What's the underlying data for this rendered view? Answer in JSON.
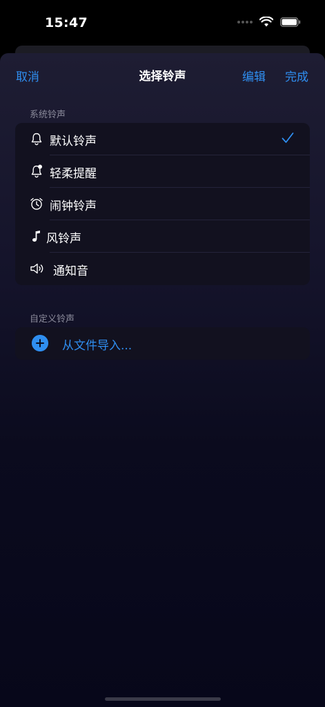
{
  "status_bar": {
    "time": "15:47"
  },
  "nav": {
    "cancel": "取消",
    "title": "选择铃声",
    "edit": "编辑",
    "done": "完成"
  },
  "sections": {
    "system": {
      "header": "系统铃声",
      "items": [
        {
          "label": "默认铃声",
          "icon": "bell-icon",
          "selected": true
        },
        {
          "label": "轻柔提醒",
          "icon": "bell-badge-icon",
          "selected": false
        },
        {
          "label": "闹钟铃声",
          "icon": "alarm-clock-icon",
          "selected": false
        },
        {
          "label": "风铃声",
          "icon": "music-note-icon",
          "selected": false
        },
        {
          "label": "通知音",
          "icon": "speaker-icon",
          "selected": false
        }
      ]
    },
    "custom": {
      "header": "自定义铃声",
      "import_label": "从文件导入..."
    }
  },
  "colors": {
    "accent": "#2f8ef0",
    "background": "#0b0b1e"
  }
}
